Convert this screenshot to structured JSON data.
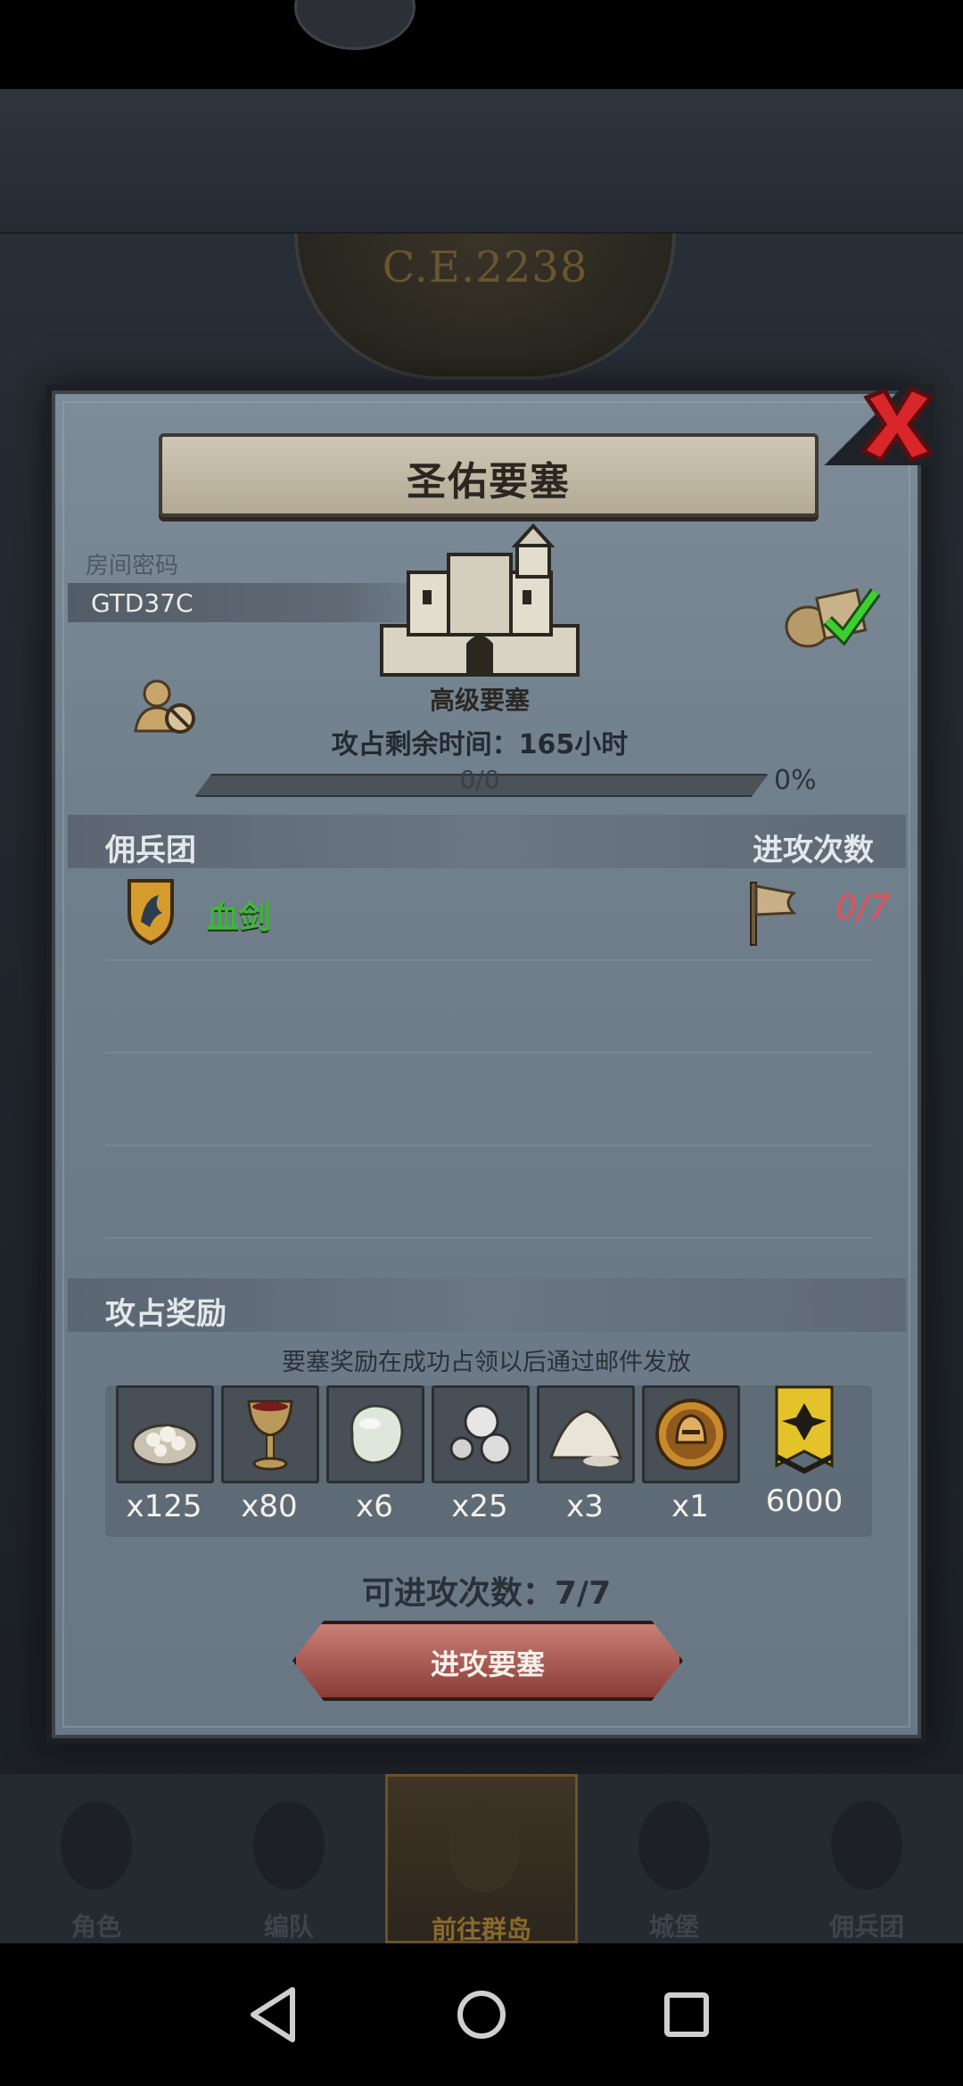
{
  "background": {
    "banner_year": "C.E.2238"
  },
  "dialog": {
    "title": "圣佑要塞",
    "room": {
      "label": "房间密码",
      "code": "GTD37C"
    },
    "fortress": {
      "name": "高级要塞",
      "time_remaining": "攻占剩余时间：165小时"
    },
    "progress": {
      "count_text": "0/0",
      "percent_text": "0%",
      "fraction": 0
    },
    "mercenary_section": {
      "label": "佣兵团",
      "right_label": "进攻次数"
    },
    "mercenaries": [
      {
        "name": "血剑",
        "attacks": "0/7"
      }
    ],
    "rewards_section": {
      "label": "攻占奖励",
      "note": "要塞奖励在成功占领以后通过邮件发放"
    },
    "rewards": [
      {
        "icon": "stone-pile-icon",
        "qty": "x125"
      },
      {
        "icon": "goblet-icon",
        "qty": "x80"
      },
      {
        "icon": "gem-icon",
        "qty": "x6"
      },
      {
        "icon": "silver-orbs-icon",
        "qty": "x25"
      },
      {
        "icon": "salt-pile-icon",
        "qty": "x3"
      },
      {
        "icon": "helmet-medal-icon",
        "qty": "x1"
      },
      {
        "icon": "banner-badge-icon",
        "qty": "6000"
      }
    ],
    "attack_count": "可进攻次数：7/7",
    "attack_button": "进攻要塞"
  },
  "bottom_nav": [
    {
      "label": "角色"
    },
    {
      "label": "编队"
    },
    {
      "label": "前往群岛",
      "active": true
    },
    {
      "label": "城堡"
    },
    {
      "label": "佣兵团"
    }
  ],
  "colors": {
    "accent_green": "#3fb63a",
    "count_red": "#e25257",
    "button_red": "#8a3b36"
  }
}
